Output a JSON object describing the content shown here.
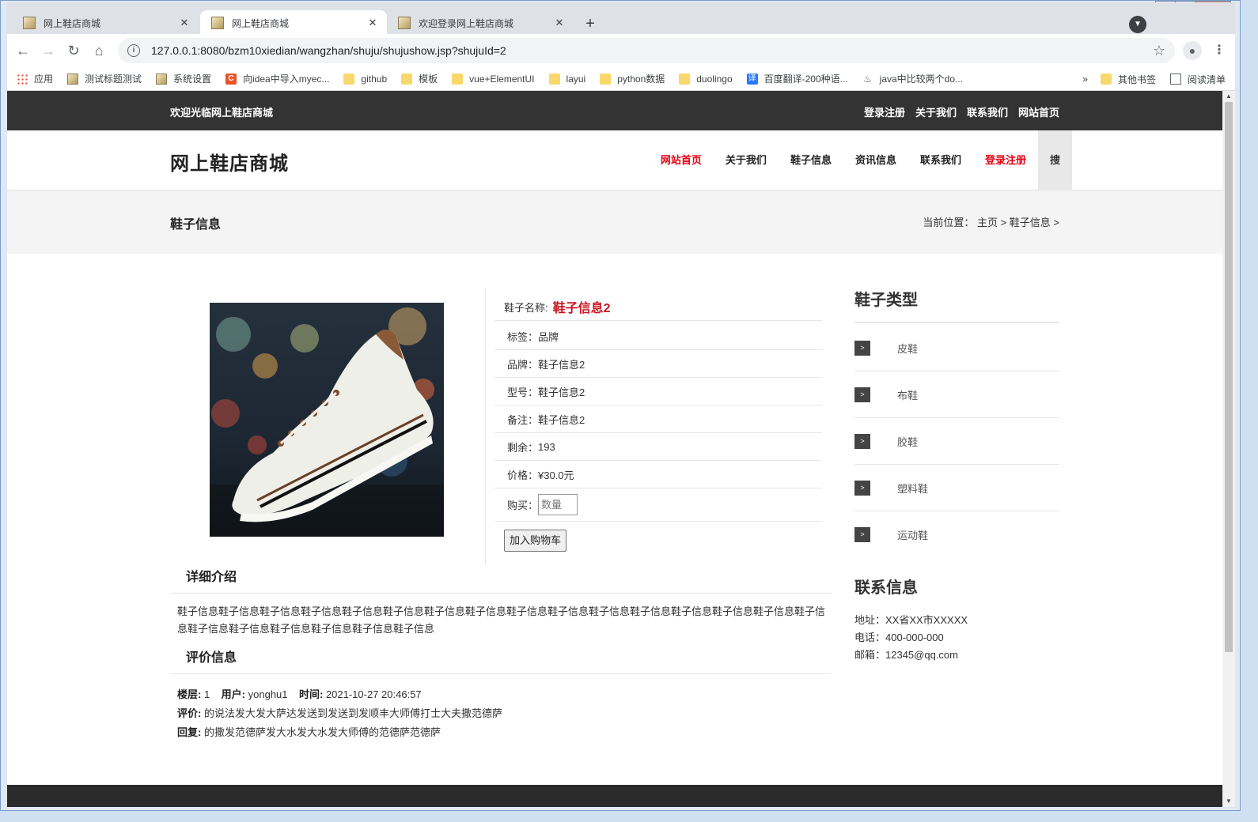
{
  "browser": {
    "tabs": [
      {
        "title": "网上鞋店商城",
        "active": false
      },
      {
        "title": "网上鞋店商城",
        "active": true
      },
      {
        "title": "欢迎登录网上鞋店商城",
        "active": false
      }
    ],
    "new_tab_label": "+",
    "url": "127.0.0.1:8080/bzm10xiedian/wangzhan/shuju/shujushow.jsp?shujuId=2",
    "bookmarks": [
      {
        "label": "应用",
        "icon": "apps-icon"
      },
      {
        "label": "测试标题测试",
        "icon": "page-icon"
      },
      {
        "label": "系统设置",
        "icon": "page-icon"
      },
      {
        "label": "向idea中导入myec...",
        "icon": "c-icon"
      },
      {
        "label": "github",
        "icon": "folder-icon"
      },
      {
        "label": "模板",
        "icon": "folder-icon"
      },
      {
        "label": "vue+ElementUI",
        "icon": "folder-icon"
      },
      {
        "label": "layui",
        "icon": "folder-icon"
      },
      {
        "label": "python数据",
        "icon": "folder-icon"
      },
      {
        "label": "duolingo",
        "icon": "folder-icon"
      },
      {
        "label": "百度翻译-200种语...",
        "icon": "translate-icon"
      },
      {
        "label": "java中比较两个do...",
        "icon": "java-icon"
      }
    ],
    "bookmarks_more": "»",
    "other_bookmarks": "其他书签",
    "reading_list": "阅读清单"
  },
  "topbar": {
    "welcome": "欢迎光临网上鞋店商城",
    "links": [
      "登录注册",
      "关于我们",
      "联系我们",
      "网站首页"
    ]
  },
  "header": {
    "logo": "网上鞋店商城",
    "nav": [
      {
        "label": "网站首页",
        "highlight": true
      },
      {
        "label": "关于我们",
        "highlight": false
      },
      {
        "label": "鞋子信息",
        "highlight": false
      },
      {
        "label": "资讯信息",
        "highlight": false
      },
      {
        "label": "联系我们",
        "highlight": false
      },
      {
        "label": "登录注册",
        "highlight": true
      }
    ],
    "search": "搜"
  },
  "crumbbar": {
    "title": "鞋子信息",
    "crumb_prefix": "当前位置：",
    "crumb_path": "主页 > 鞋子信息 >"
  },
  "product": {
    "name_label": "鞋子名称:",
    "name": "鞋子信息2",
    "fields": [
      {
        "label": "标签：",
        "value": "品牌"
      },
      {
        "label": "品牌：",
        "value": "鞋子信息2"
      },
      {
        "label": "型号：",
        "value": "鞋子信息2"
      },
      {
        "label": "备注：",
        "value": "鞋子信息2"
      },
      {
        "label": "剩余：",
        "value": "193"
      },
      {
        "label": "价格：",
        "value": "¥30.0元"
      }
    ],
    "buy_label": "购买：",
    "qty_placeholder": "数量",
    "cart_button": "加入购物车"
  },
  "details": {
    "title": "详细介绍",
    "text": "鞋子信息鞋子信息鞋子信息鞋子信息鞋子信息鞋子信息鞋子信息鞋子信息鞋子信息鞋子信息鞋子信息鞋子信息鞋子信息鞋子信息鞋子信息鞋子信息鞋子信息鞋子信息鞋子信息鞋子信息鞋子信息鞋子信息"
  },
  "reviews": {
    "title": "评价信息",
    "floor_label": "楼层:",
    "floor": "1",
    "user_label": "用户:",
    "user": "yonghu1",
    "time_label": "时间:",
    "time": "2021-10-27 20:46:57",
    "comment_label": "评价:",
    "comment": "的说法发大发大萨达发送到发送到发顺丰大师傅打士大夫撒范德萨",
    "reply_label": "回复:",
    "reply": "的撒发范德萨发大水发大水发大师傅的范德萨范德萨"
  },
  "sidebar": {
    "categories_title": "鞋子类型",
    "categories": [
      "皮鞋",
      "布鞋",
      "胶鞋",
      "塑料鞋",
      "运动鞋"
    ],
    "contact_title": "联系信息",
    "address": "地址：XX省XX市XXXXX",
    "phone": "电话：400-000-000",
    "email": "邮箱：12345@qq.com"
  },
  "colors": {
    "accent_red": "#e60012",
    "price_red": "#c81623",
    "topbar_bg": "#333333"
  }
}
